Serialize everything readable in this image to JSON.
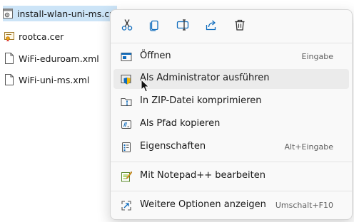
{
  "files": [
    {
      "name": "install-wlan-uni-ms.cmd",
      "icon": "script-file-icon",
      "selected": true
    },
    {
      "name": "rootca.cer",
      "icon": "certificate-icon",
      "selected": false
    },
    {
      "name": "WiFi-eduroam.xml",
      "icon": "document-icon",
      "selected": false
    },
    {
      "name": "WiFi-uni-ms.xml",
      "icon": "document-icon",
      "selected": false
    }
  ],
  "context_menu": {
    "quick_actions": [
      {
        "name": "cut-icon"
      },
      {
        "name": "copy-icon"
      },
      {
        "name": "rename-icon"
      },
      {
        "name": "share-icon"
      },
      {
        "name": "delete-icon"
      }
    ],
    "items": [
      {
        "label": "Öffnen",
        "shortcut": "Eingabe",
        "icon": "open-icon"
      },
      {
        "label": "Als Administrator ausführen",
        "shortcut": "",
        "icon": "shield-icon",
        "hover": true
      },
      {
        "label": "In ZIP-Datei komprimieren",
        "shortcut": "",
        "icon": "zip-folder-icon"
      },
      {
        "label": "Als Pfad kopieren",
        "shortcut": "",
        "icon": "copy-path-icon"
      },
      {
        "label": "Eigenschaften",
        "shortcut": "Alt+Eingabe",
        "icon": "properties-icon"
      },
      {
        "label": "Mit Notepad++ bearbeiten",
        "shortcut": "",
        "icon": "notepad-plus-plus-icon"
      },
      {
        "label": "Weitere Optionen anzeigen",
        "shortcut": "Umschalt+F10",
        "icon": "more-options-icon"
      }
    ]
  },
  "colors": {
    "selection": "#cce4f7",
    "accent_blue": "#0f6cbd",
    "menu_bg": "#f9f9f9",
    "hover_bg": "#ebebeb"
  }
}
